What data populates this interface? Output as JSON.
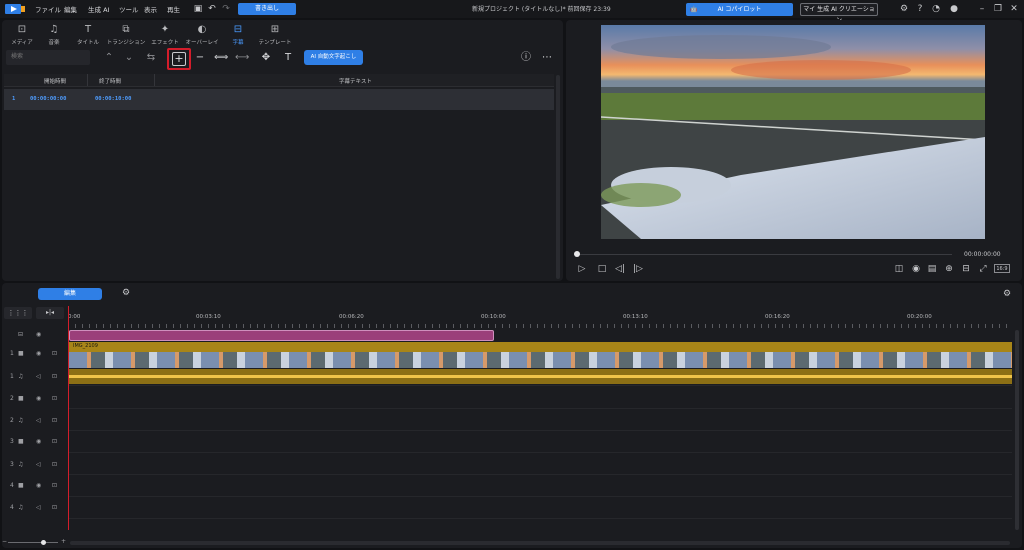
{
  "menu": [
    "ファイル",
    "編集",
    "生成 AI",
    "ツール",
    "表示",
    "再生"
  ],
  "export_label": "書き出し",
  "project_title": "新規プロジェクト (タイトルなし)* 前回保存 23:39",
  "ai_copilot_label": "AI コパイロット",
  "ai_creation_label": "マイ 生成 AI クリエーション",
  "tabs": [
    {
      "label": "メディア",
      "icon": "media-icon"
    },
    {
      "label": "音楽",
      "icon": "music-icon"
    },
    {
      "label": "タイトル",
      "icon": "title-icon"
    },
    {
      "label": "トランジション",
      "icon": "transition-icon"
    },
    {
      "label": "エフェクト",
      "icon": "effect-icon"
    },
    {
      "label": "オーバーレイ",
      "icon": "overlay-icon"
    },
    {
      "label": "字幕",
      "icon": "subtitle-icon",
      "active": true
    },
    {
      "label": "テンプレート",
      "icon": "template-icon"
    }
  ],
  "search_placeholder": "検索",
  "ai_subtitle_label": "AI 自動文字起こし",
  "subtitle_table": {
    "headers": [
      "開始時間",
      "終了時間",
      "字幕テキスト"
    ],
    "rows": [
      {
        "index": "1",
        "start": "00:00:00:00",
        "end": "00:00:10:00",
        "text": ""
      }
    ]
  },
  "preview": {
    "timecode": "00:00:00:00",
    "quality": "16:9"
  },
  "timeline": {
    "edit_tab": "編集",
    "ruler": [
      "0:00",
      "00:03:10",
      "00:06:20",
      "00:10:00",
      "00:13:10",
      "00:16:20",
      "00:20:00"
    ],
    "video_clip_label": "IMG_2109",
    "track_numbers": [
      "1",
      "1",
      "2",
      "2",
      "3",
      "3",
      "4",
      "4"
    ]
  },
  "colors": {
    "accent": "#2f7fe6",
    "highlight_red": "#d41d2b",
    "subtitle_clip": "#9b3f7a",
    "video_clip": "#a88518"
  }
}
